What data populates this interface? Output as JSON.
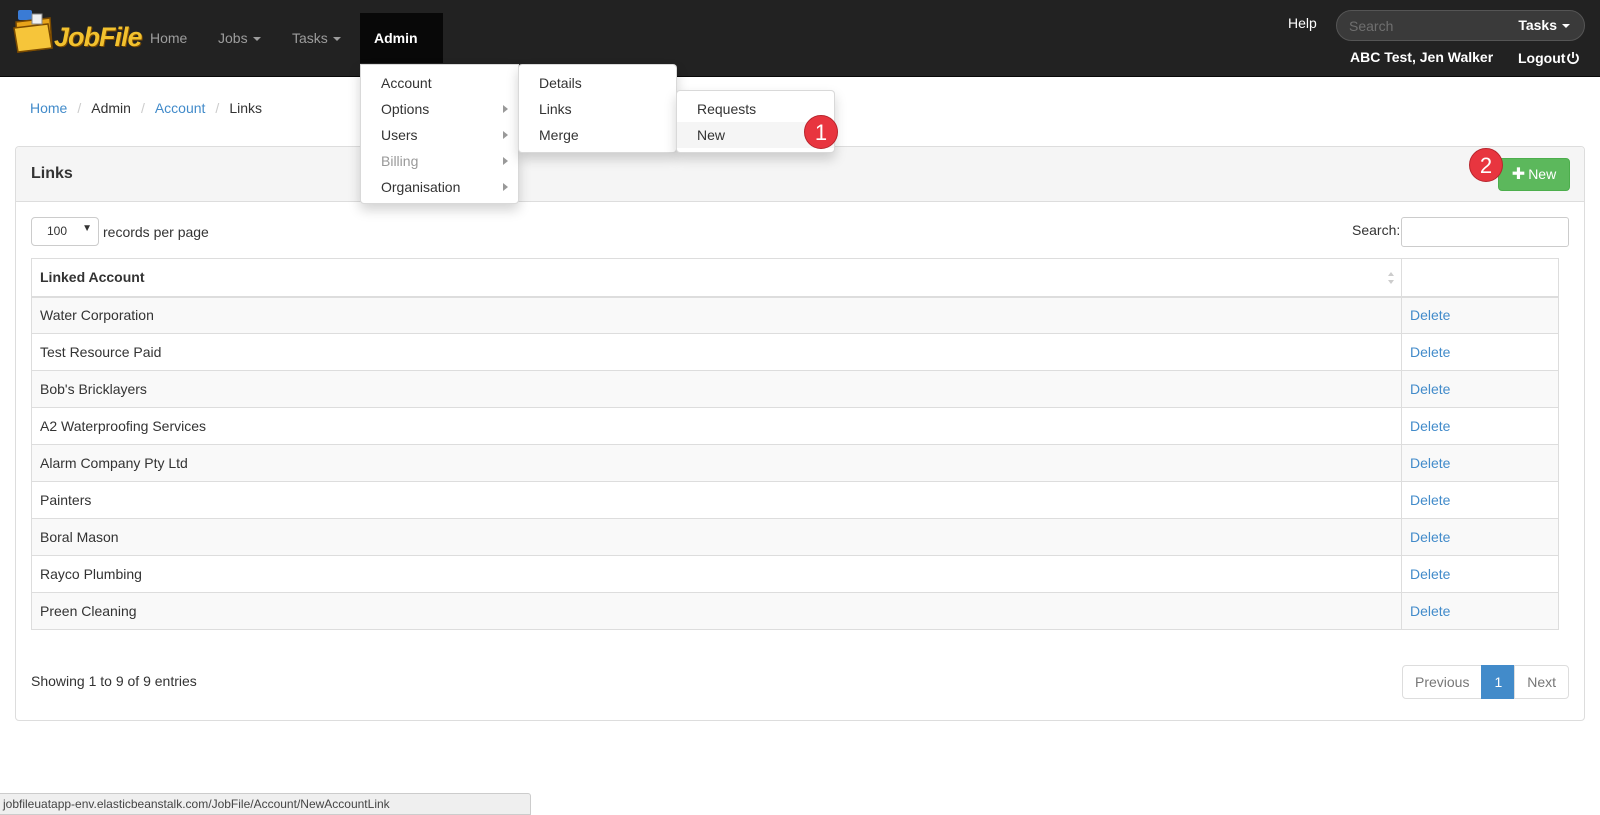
{
  "brand": {
    "text": "JobFile"
  },
  "nav": {
    "items": [
      {
        "label": "Home"
      },
      {
        "label": "Jobs"
      },
      {
        "label": "Tasks"
      },
      {
        "label": "Admin"
      }
    ],
    "help": "Help",
    "search_placeholder": "Search",
    "search_scope": "Tasks",
    "user": "ABC Test, Jen Walker",
    "logout": "Logout"
  },
  "breadcrumb": [
    "Home",
    "Admin",
    "Account",
    "Links"
  ],
  "panel": {
    "title": "Links",
    "new_button": "New",
    "per_page_value": "100",
    "per_page_label": "records per page",
    "search_label": "Search:"
  },
  "table": {
    "headers": [
      "Linked Account",
      ""
    ],
    "rows": [
      {
        "name": "Water Corporation",
        "action": "Delete"
      },
      {
        "name": "Test Resource Paid",
        "action": "Delete"
      },
      {
        "name": "Bob's Bricklayers",
        "action": "Delete"
      },
      {
        "name": "A2 Waterproofing Services",
        "action": "Delete"
      },
      {
        "name": "Alarm Company Pty Ltd",
        "action": "Delete"
      },
      {
        "name": "Painters",
        "action": "Delete"
      },
      {
        "name": "Boral Mason",
        "action": "Delete"
      },
      {
        "name": "Rayco Plumbing",
        "action": "Delete"
      },
      {
        "name": "Preen Cleaning",
        "action": "Delete"
      }
    ]
  },
  "footer": {
    "showing": "Showing 1 to 9 of 9 entries",
    "prev": "Previous",
    "page": "1",
    "next": "Next"
  },
  "admin_menu": {
    "items": [
      {
        "label": "Account"
      },
      {
        "label": "Options"
      },
      {
        "label": "Users"
      },
      {
        "label": "Billing"
      },
      {
        "label": "Organisation"
      }
    ]
  },
  "account_menu": {
    "items": [
      {
        "label": "Details"
      },
      {
        "label": "Links"
      },
      {
        "label": "Merge"
      }
    ]
  },
  "links_menu": {
    "items": [
      {
        "label": "Requests"
      },
      {
        "label": "New"
      }
    ]
  },
  "annotations": {
    "step1": "1",
    "step2": "2"
  },
  "status_url": "jobfileuatapp-env.elasticbeanstalk.com/JobFile/Account/NewAccountLink",
  "colors": {
    "navbar": "#222222",
    "link": "#428bca",
    "success": "#5cb85c",
    "annotation": "#e8353f"
  }
}
